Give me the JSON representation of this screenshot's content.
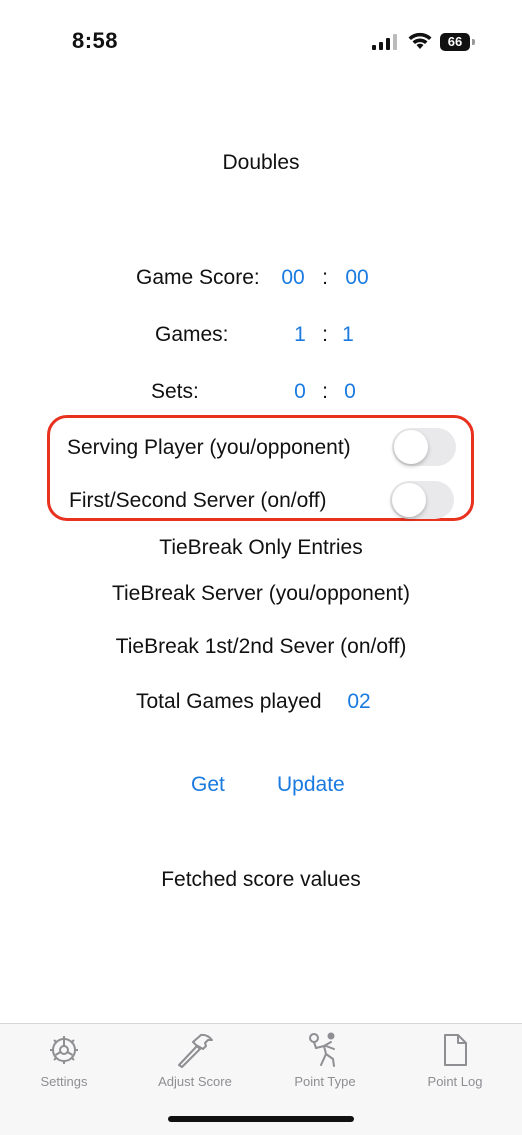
{
  "status_bar": {
    "time": "8:58",
    "battery": "66"
  },
  "title": "Doubles",
  "game_score": {
    "label": "Game Score:",
    "left": "00",
    "sep": ":",
    "right": "00"
  },
  "games": {
    "label": "Games:",
    "left": "1",
    "sep": ":",
    "right": "1"
  },
  "sets": {
    "label": "Sets:",
    "left": "0",
    "sep": ":",
    "right": "0"
  },
  "serving_player": {
    "label": "Serving Player (you/opponent)",
    "on": false
  },
  "first_second_server": {
    "label": "First/Second Server (on/off)",
    "on": false
  },
  "tiebreak_header": "TieBreak Only Entries",
  "tiebreak_server": "TieBreak Server (you/opponent)",
  "tiebreak_sever": "TieBreak 1st/2nd Sever (on/off)",
  "total_games": {
    "label": "Total Games played",
    "value": "02"
  },
  "buttons": {
    "get": "Get",
    "update": "Update"
  },
  "fetched_text": "Fetched score values",
  "tabs": [
    {
      "label": "Settings",
      "icon": "gear-icon"
    },
    {
      "label": "Adjust Score",
      "icon": "hammer-icon"
    },
    {
      "label": "Point Type",
      "icon": "tennis-player-icon"
    },
    {
      "label": "Point Log",
      "icon": "document-icon"
    }
  ],
  "colors": {
    "accent": "#1a7ae0",
    "highlight": "#e8321f",
    "tab_gray": "#8e8e93"
  }
}
